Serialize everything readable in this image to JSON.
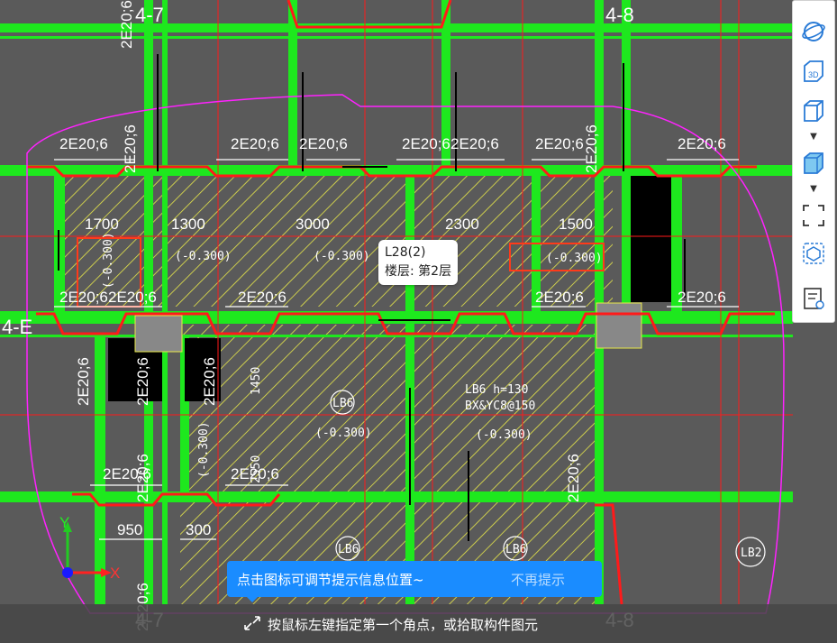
{
  "axis_labels": {
    "top_left": "4-7",
    "top_right": "4-8",
    "left_row": "4-E",
    "bottom_left": "4-7",
    "bottom_right": "4-8"
  },
  "rebar_labels": [
    "2E20;6",
    "2E20;6",
    "2E20;6",
    "2E20;6",
    "2E20;6",
    "2E20;6",
    "2E20;6",
    "2E20;6",
    "2E20;6",
    "2E20;6",
    "2E20;6",
    "2E20;6",
    "2E20;6",
    "2E20;6",
    "2E20;6",
    "2E20;6"
  ],
  "vertical_rebar_labels": [
    "2E20;6",
    "2E20;6",
    "2E20;6",
    "2E20;6",
    "2E20;6",
    "2E20;6",
    "2E20;6",
    "2E20;6",
    "2E20;6"
  ],
  "span_labels": [
    "1700",
    "1300",
    "3000",
    "2300",
    "1500"
  ],
  "elevation_labels": [
    "(-0.300)",
    "(-0.300)",
    "(-0.300)",
    "(-0.300)",
    "(-0.300)",
    "(-0.300)",
    "(-0.300)"
  ],
  "slab_labels": {
    "lb6_a": "LB6",
    "lb6_b": "LB6",
    "lb6_c": "LB6",
    "lb2": "LB2"
  },
  "slab_spec": {
    "line1": "LB6 h=130",
    "line2": "BX&YC8@150"
  },
  "dims": {
    "d1450": "1450",
    "d950": "950",
    "d300": "300",
    "d550": "2550"
  },
  "tooltip": {
    "title": "L28(2)",
    "floor": "楼层: 第2层"
  },
  "hint": {
    "message": "点击图标可调节提示信息位置~",
    "dismiss": "不再提示"
  },
  "status": {
    "text": "按鼠标左键指定第一个角点，或拾取构件图元"
  },
  "ucs": {
    "x": "X",
    "y": "Y"
  },
  "toolbar": [
    "orbit-icon",
    "3d-view-icon",
    "box-view-icon",
    "solid-box-icon",
    "select-region-icon",
    "component-icon",
    "properties-list-icon"
  ],
  "colors": {
    "beam_green": "#1ee81e",
    "rebar_red": "#ff1a1a",
    "hatch_yellow": "#e8e84a",
    "hint_blue": "#1a8cff",
    "magenta": "#ff22ff"
  }
}
